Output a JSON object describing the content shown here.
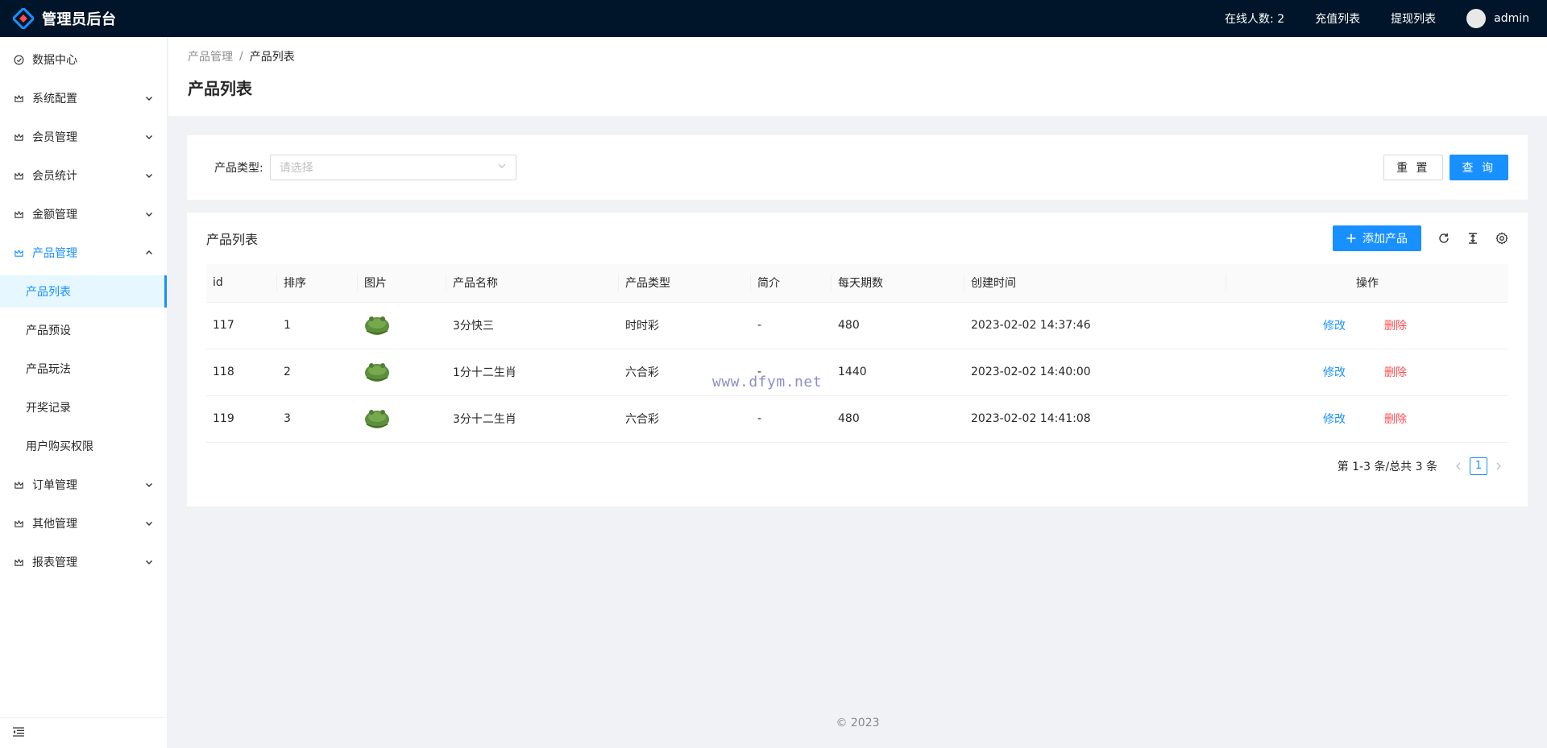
{
  "app": {
    "title": "管理员后台"
  },
  "header": {
    "online_label": "在线人数: 2",
    "recharge_label": "充值列表",
    "withdraw_label": "提现列表",
    "user_name": "admin"
  },
  "sidebar": {
    "items": [
      {
        "label": "数据中心",
        "icon": "dashboard-icon",
        "arrow": "none"
      },
      {
        "label": "系统配置",
        "icon": "crown-icon",
        "arrow": "down"
      },
      {
        "label": "会员管理",
        "icon": "crown-icon",
        "arrow": "down"
      },
      {
        "label": "会员统计",
        "icon": "crown-icon",
        "arrow": "down"
      },
      {
        "label": "金额管理",
        "icon": "crown-icon",
        "arrow": "down"
      },
      {
        "label": "产品管理",
        "icon": "crown-icon",
        "arrow": "up"
      }
    ],
    "sub_items": [
      "产品列表",
      "产品预设",
      "产品玩法",
      "开奖记录",
      "用户购买权限"
    ],
    "items_after": [
      {
        "label": "订单管理",
        "icon": "crown-icon",
        "arrow": "down"
      },
      {
        "label": "其他管理",
        "icon": "crown-icon",
        "arrow": "down"
      },
      {
        "label": "报表管理",
        "icon": "crown-icon",
        "arrow": "down"
      }
    ]
  },
  "breadcrumb": {
    "parent": "产品管理",
    "separator": "/",
    "current": "产品列表"
  },
  "page_title": "产品列表",
  "search": {
    "type_label": "产品类型:",
    "type_placeholder": "请选择",
    "reset_label": "重 置",
    "query_label": "查 询"
  },
  "table_card": {
    "title": "产品列表",
    "add_label": "添加产品",
    "columns": [
      "id",
      "排序",
      "图片",
      "产品名称",
      "产品类型",
      "简介",
      "每天期数",
      "创建时间",
      "操作"
    ],
    "rows": [
      {
        "id": "117",
        "sort": "1",
        "name": "3分快三",
        "type": "时时彩",
        "intro": "-",
        "periods": "480",
        "created": "2023-02-02 14:37:46",
        "edit": "修改",
        "delete": "删除"
      },
      {
        "id": "118",
        "sort": "2",
        "name": "1分十二生肖",
        "type": "六合彩",
        "intro": "-",
        "periods": "1440",
        "created": "2023-02-02 14:40:00",
        "edit": "修改",
        "delete": "删除"
      },
      {
        "id": "119",
        "sort": "3",
        "name": "3分十二生肖",
        "type": "六合彩",
        "intro": "-",
        "periods": "480",
        "created": "2023-02-02 14:41:08",
        "edit": "修改",
        "delete": "删除"
      }
    ]
  },
  "pagination": {
    "total_text": "第 1-3 条/总共 3 条",
    "current_page": "1"
  },
  "watermark": "www.dfym.net",
  "footer": {
    "copyright": "© 2023"
  },
  "colors": {
    "header_bg": "#001529",
    "primary": "#1890ff",
    "danger": "#ff4d4f",
    "active_bg": "#e6f7ff"
  }
}
